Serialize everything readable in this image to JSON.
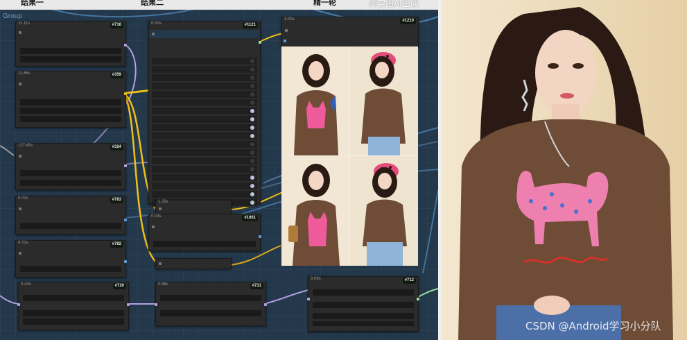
{
  "window": {
    "title_segments": [
      "结果一",
      "结果二",
      "精一轮"
    ],
    "ai_notice": "内容由AI生成"
  },
  "canvas": {
    "group_label": "Group"
  },
  "nodes": {
    "n716": {
      "id": "#716",
      "time": "11.11s"
    },
    "n359": {
      "id": "#359",
      "time": "11.65s"
    },
    "n324": {
      "id": "#324",
      "time": "127.45s"
    },
    "n783": {
      "id": "#783",
      "time": "0.01s"
    },
    "n782": {
      "id": "#782",
      "time": "0.01s"
    },
    "n720": {
      "id": "#720",
      "time": "0.43s"
    },
    "n1121": {
      "id": "#1121",
      "time": "0.00s"
    },
    "n1061": {
      "id": "#1061",
      "time": "0.03s"
    },
    "n1210": {
      "id": "#1210",
      "time": "3.00s"
    },
    "n731": {
      "id": "#731",
      "time": "0.58s"
    },
    "n712": {
      "id": "#712",
      "time": "0.09s"
    },
    "reroute": {
      "time": "1.29s"
    }
  },
  "preview_images": [
    "sweater-front-cat",
    "sweater-beret-side",
    "sweater-front-bag",
    "sweater-beret-jeans"
  ],
  "output_photo": {
    "watermark": "CSDN @Android学习小分队"
  },
  "colors": {
    "canvas": "#23384b",
    "wire_yellow": "#f2c014",
    "wire_purple": "#b6a0e0",
    "wire_blue": "#5e9fd9",
    "sweater": "#6e4c36",
    "cat_pink": "#ee5a9a"
  }
}
